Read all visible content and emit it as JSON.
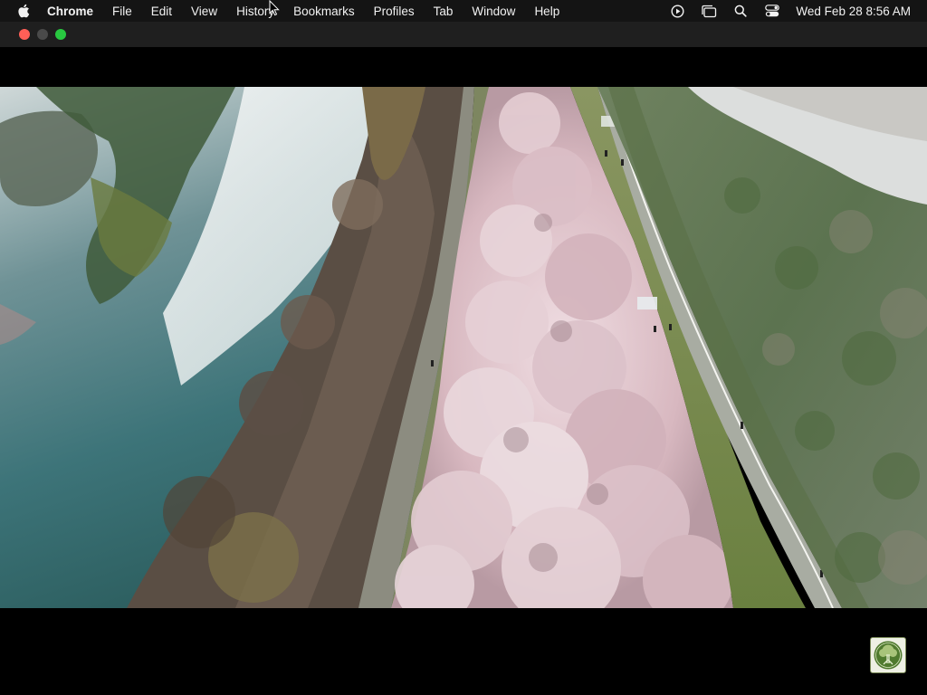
{
  "menubar": {
    "apple_icon": "apple-logo-icon",
    "app_name": "Chrome",
    "menus": [
      "File",
      "Edit",
      "View",
      "History",
      "Bookmarks",
      "Profiles",
      "Tab",
      "Window",
      "Help"
    ],
    "status_icons": [
      "play-circle-icon",
      "stacked-windows-icon",
      "search-icon",
      "control-center-icon"
    ],
    "clock": "Wed Feb 28  8:56 AM"
  },
  "window": {
    "traffic_lights": {
      "close_color": "#ff5f57",
      "minimize_color": "#4a4a4a",
      "zoom_color": "#28c840"
    }
  },
  "video": {
    "scene": "aerial-cherry-blossom-riverside",
    "channel_logo": "tree-logo-icon"
  }
}
